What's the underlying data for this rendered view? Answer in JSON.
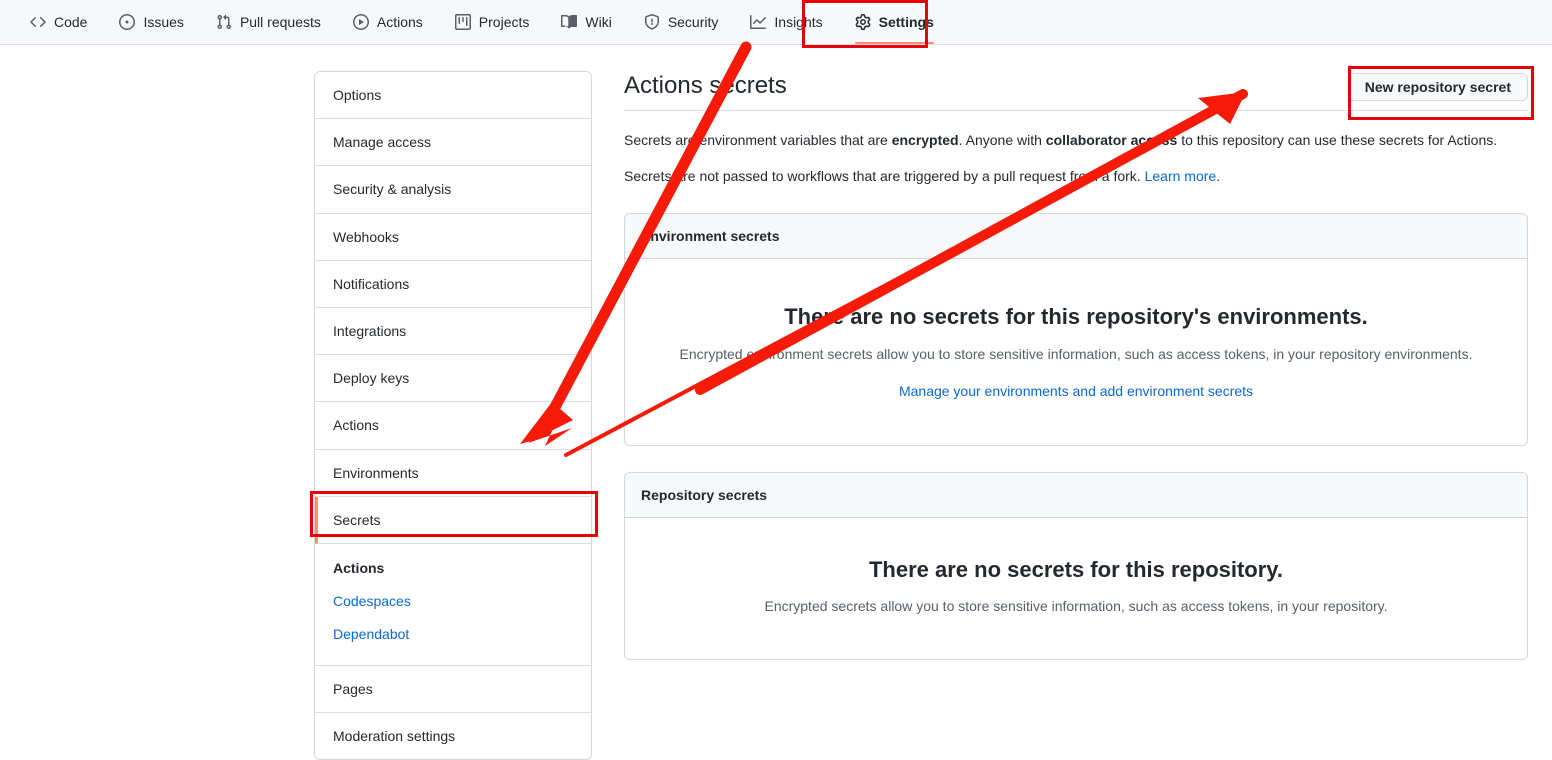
{
  "repo_nav": {
    "items": [
      {
        "label": "Code",
        "icon": "code-icon",
        "selected": false
      },
      {
        "label": "Issues",
        "icon": "issue-opened-icon",
        "selected": false
      },
      {
        "label": "Pull requests",
        "icon": "git-pull-request-icon",
        "selected": false
      },
      {
        "label": "Actions",
        "icon": "play-icon",
        "selected": false
      },
      {
        "label": "Projects",
        "icon": "project-icon",
        "selected": false
      },
      {
        "label": "Wiki",
        "icon": "book-icon",
        "selected": false
      },
      {
        "label": "Security",
        "icon": "shield-icon",
        "selected": false
      },
      {
        "label": "Insights",
        "icon": "graph-icon",
        "selected": false
      },
      {
        "label": "Settings",
        "icon": "gear-icon",
        "selected": true
      }
    ]
  },
  "sidebar": {
    "items": [
      {
        "label": "Options"
      },
      {
        "label": "Manage access"
      },
      {
        "label": "Security & analysis"
      },
      {
        "label": "Webhooks"
      },
      {
        "label": "Notifications"
      },
      {
        "label": "Integrations"
      },
      {
        "label": "Deploy keys"
      },
      {
        "label": "Actions"
      },
      {
        "label": "Environments"
      },
      {
        "label": "Secrets"
      }
    ],
    "secrets_subitems": [
      {
        "label": "Actions",
        "active": true
      },
      {
        "label": "Codespaces",
        "active": false
      },
      {
        "label": "Dependabot",
        "active": false
      }
    ],
    "tail_items": [
      {
        "label": "Pages"
      },
      {
        "label": "Moderation settings"
      }
    ]
  },
  "main": {
    "title": "Actions secrets",
    "new_secret_button": "New repository secret",
    "desc1_a": "Secrets are environment variables that are ",
    "desc1_b": "encrypted",
    "desc1_c": ". Anyone with ",
    "desc1_d": "collaborator access",
    "desc1_e": " to this repository can use these secrets for Actions.",
    "desc2_a": "Secrets are not passed to workflows that are triggered by a pull request from a fork. ",
    "desc2_link": "Learn more",
    "desc2_end": ".",
    "environment_box": {
      "header": "Environment secrets",
      "blank_title": "There are no secrets for this repository's environments.",
      "blank_text": "Encrypted environment secrets allow you to store sensitive information, such as access tokens, in your repository environments.",
      "blank_link": "Manage your environments and add environment secrets"
    },
    "repository_box": {
      "header": "Repository secrets",
      "blank_title": "There are no secrets for this repository.",
      "blank_text": "Encrypted secrets allow you to store sensitive information, such as access tokens, in your repository."
    }
  },
  "annotations": {
    "color": "#e8000d",
    "highlight_boxes": [
      {
        "name": "settings-tab-highlight"
      },
      {
        "name": "new-repository-secret-highlight"
      },
      {
        "name": "secrets-sidebar-highlight"
      }
    ],
    "arrows": [
      {
        "name": "settings-to-secrets-arrow",
        "style": "thick"
      },
      {
        "name": "sidebar-to-new-secret-arrow",
        "style": "thin"
      }
    ]
  },
  "colors": {
    "accent_underline": "#fd8c73",
    "link": "#0969da",
    "annotation_red": "#e8000d",
    "nav_background": "#f6f8fa",
    "border": "#d0d7de"
  }
}
